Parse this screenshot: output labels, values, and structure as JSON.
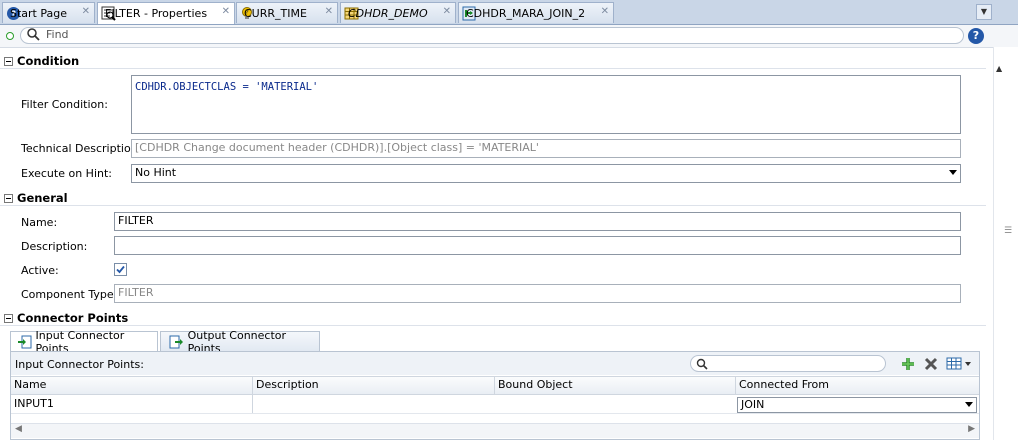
{
  "tabs": [
    {
      "label": "Start Page",
      "icon": "help-circle-icon",
      "italic": false,
      "active": false
    },
    {
      "label": "FILTER - Properties",
      "icon": "filter-properties-icon",
      "italic": false,
      "active": true
    },
    {
      "label": "CURR_TIME",
      "icon": "lightbulb-icon",
      "italic": false,
      "active": false
    },
    {
      "label": "CDHDR_DEMO",
      "icon": "table-icon",
      "italic": true,
      "active": false
    },
    {
      "label": "CDHDR_MARA_JOIN_2",
      "icon": "join-icon",
      "italic": false,
      "active": false
    }
  ],
  "find": {
    "placeholder": "Find"
  },
  "condition": {
    "header": "Condition",
    "filter_label": "Filter Condition:",
    "filter_value": "CDHDR.OBJECTCLAS = 'MATERIAL'",
    "tech_label": "Technical Description:",
    "tech_value": "[CDHDR  Change document header (CDHDR)].[Object class] = 'MATERIAL'",
    "hint_label": "Execute on Hint:",
    "hint_value": "No Hint"
  },
  "general": {
    "header": "General",
    "name_label": "Name:",
    "name_value": "FILTER",
    "desc_label": "Description:",
    "desc_value": "",
    "active_label": "Active:",
    "active_checked": true,
    "comptype_label": "Component Type:",
    "comptype_value": "FILTER"
  },
  "connectors": {
    "header": "Connector Points",
    "tab_input": "Input Connector Points",
    "tab_output": "Output Connector Points",
    "panel_title": "Input Connector Points:",
    "columns": [
      "Name",
      "Description",
      "Bound Object",
      "Connected From"
    ],
    "rows": [
      {
        "name": "INPUT1",
        "description": "",
        "bound_object": "",
        "connected_from": "JOIN"
      }
    ]
  },
  "colors": {
    "accent": "#2458a8",
    "tabbar": "#c9d6e7",
    "link_blue": "#0a2a8c"
  }
}
